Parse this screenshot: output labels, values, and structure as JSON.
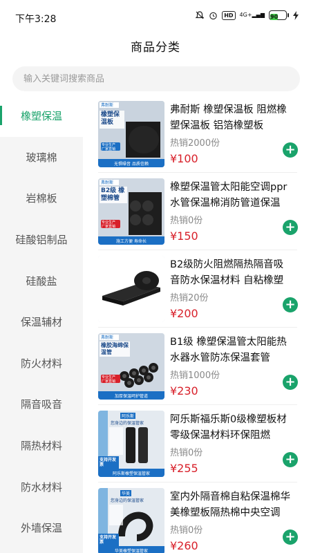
{
  "status_bar": {
    "time": "下午3:28",
    "hd": "HD",
    "network": "4G+",
    "battery": "90",
    "icons": [
      "mute-icon",
      "alarm-icon",
      "hd-icon",
      "signal-icon",
      "battery-icon",
      "charging-icon"
    ]
  },
  "header": {
    "title": "商品分类"
  },
  "search": {
    "placeholder": "输入关键词搜索商品"
  },
  "sidebar": {
    "items": [
      {
        "label": "橡塑保温",
        "active": true
      },
      {
        "label": "玻璃棉",
        "active": false
      },
      {
        "label": "岩棉板",
        "active": false
      },
      {
        "label": "硅酸铝制品",
        "active": false
      },
      {
        "label": "硅酸盐",
        "active": false
      },
      {
        "label": "保温辅材",
        "active": false
      },
      {
        "label": "防火材料",
        "active": false
      },
      {
        "label": "隔音吸音",
        "active": false
      },
      {
        "label": "隔热材料",
        "active": false
      },
      {
        "label": "防水材料",
        "active": false
      },
      {
        "label": "外墙保温",
        "active": false
      }
    ]
  },
  "products": [
    {
      "name": "弗耐斯 橡塑保温板 阻燃橡塑保温板 铝箔橡塑板",
      "sales": "热销2000份",
      "price": "¥100",
      "image": {
        "brand": "弗耐斯",
        "title": "橡塑保温板",
        "badge": "专业生产 厂家直销",
        "footer": "无惧噪音 品质信赖"
      }
    },
    {
      "name": "橡塑保温管太阳能空调ppr水管保温棉消防管道保温",
      "sales": "热销0份",
      "price": "¥150",
      "image": {
        "brand": "弗耐斯",
        "title": "B2级 橡塑棉管",
        "badge": "专业生产 厂家直销",
        "footer": "施工方便 寿命长"
      }
    },
    {
      "name": "B2级防火阻燃隔热隔音吸音防水保温材料 自粘橡塑",
      "sales": "热销20份",
      "price": "¥200",
      "image": {
        "brand": "",
        "title": "",
        "badge": "",
        "footer": ""
      }
    },
    {
      "name": "B1级 橡塑保温管太阳能热水器水管防冻保温套管",
      "sales": "热销1000份",
      "price": "¥230",
      "image": {
        "brand": "弗耐斯",
        "title": "橡胶海绵保温管",
        "badge": "专业生产 厂家直销",
        "footer": "加厚保温呵护管道"
      }
    },
    {
      "name": "阿乐斯福乐斯0级橡塑板材零级保温材料环保阻燃",
      "sales": "热销0份",
      "price": "¥255",
      "image": {
        "brand": "阿乐斯",
        "title": "您身边的保温管家",
        "badge": "支持开发票",
        "footer": "阿乐斯橡塑保温管家"
      }
    },
    {
      "name": "室内外隔音棉自粘保温棉华美橡塑板隔热棉中央空调",
      "sales": "热销0份",
      "price": "¥260",
      "image": {
        "brand": "华美",
        "title": "您身边的保温管家",
        "badge": "支持开发票",
        "footer": "华美橡塑保温管家"
      }
    }
  ],
  "colors": {
    "accent": "#1aa36b",
    "price": "#d8202a",
    "sidebar_bg": "#f5f5f5"
  }
}
